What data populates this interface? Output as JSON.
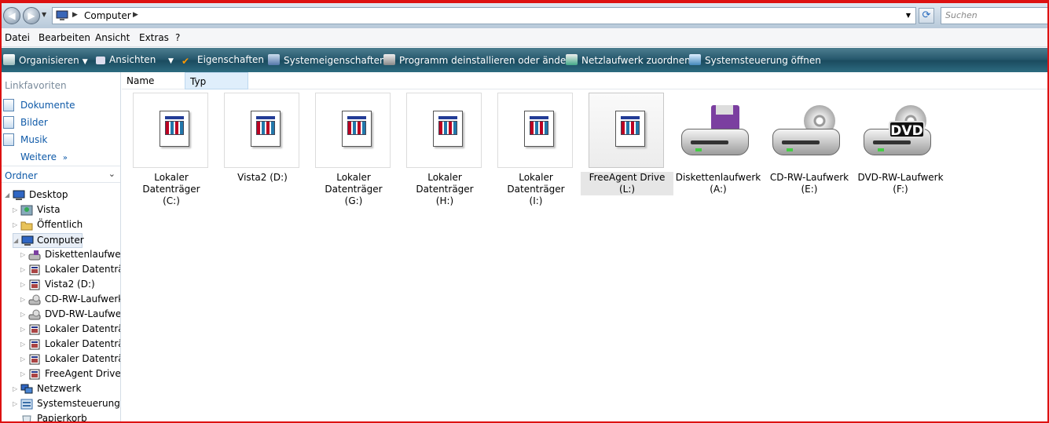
{
  "address_bar": {
    "path_label": "Computer",
    "search_placeholder": "Suchen"
  },
  "menu": [
    "Datei",
    "Bearbeiten",
    "Ansicht",
    "Extras",
    "?"
  ],
  "toolbar": {
    "organize": "Organisieren",
    "views": "Ansichten",
    "properties": "Eigenschaften",
    "system_properties": "Systemeigenschaften",
    "uninstall": "Programm deinstallieren oder ändern",
    "map_drive": "Netzlaufwerk zuordnen",
    "control_panel": "Systemsteuerung öffnen"
  },
  "sidebar": {
    "links_header": "Linkfavoriten",
    "links": [
      "Dokumente",
      "Bilder",
      "Musik",
      "Weitere"
    ],
    "folders_header": "Ordner",
    "tree": [
      "Desktop",
      "Vista",
      "Öffentlich",
      "Computer",
      "Diskettenlaufwerk",
      "Lokaler Datenträg",
      "Vista2 (D:)",
      "CD-RW-Laufwerk",
      "DVD-RW-Laufwer",
      "Lokaler Datenträg",
      "Lokaler Datenträg",
      "Lokaler Datenträg",
      "FreeAgent Drive (I",
      "Netzwerk",
      "Systemsteuerung",
      "Papierkorb"
    ]
  },
  "columns": {
    "name": "Name",
    "type": "Typ"
  },
  "drives": [
    {
      "line1": "Lokaler Datenträger",
      "line2": "(C:)",
      "icon": "hard-disk-icon"
    },
    {
      "line1": "Vista2 (D:)",
      "line2": "",
      "icon": "hard-disk-icon"
    },
    {
      "line1": "Lokaler Datenträger",
      "line2": "(G:)",
      "icon": "hard-disk-icon"
    },
    {
      "line1": "Lokaler Datenträger",
      "line2": "(H:)",
      "icon": "hard-disk-icon"
    },
    {
      "line1": "Lokaler Datenträger",
      "line2": "(I:)",
      "icon": "hard-disk-icon"
    },
    {
      "line1": "FreeAgent Drive (L:)",
      "line2": "",
      "icon": "hard-disk-icon"
    },
    {
      "line1": "Diskettenlaufwerk",
      "line2": "(A:)",
      "icon": "floppy-drive-icon"
    },
    {
      "line1": "CD-RW-Laufwerk",
      "line2": "(E:)",
      "icon": "cd-drive-icon"
    },
    {
      "line1": "DVD-RW-Laufwerk",
      "line2": "(F:)",
      "icon": "dvd-drive-icon"
    }
  ],
  "dvd_icon_text": "DVD"
}
